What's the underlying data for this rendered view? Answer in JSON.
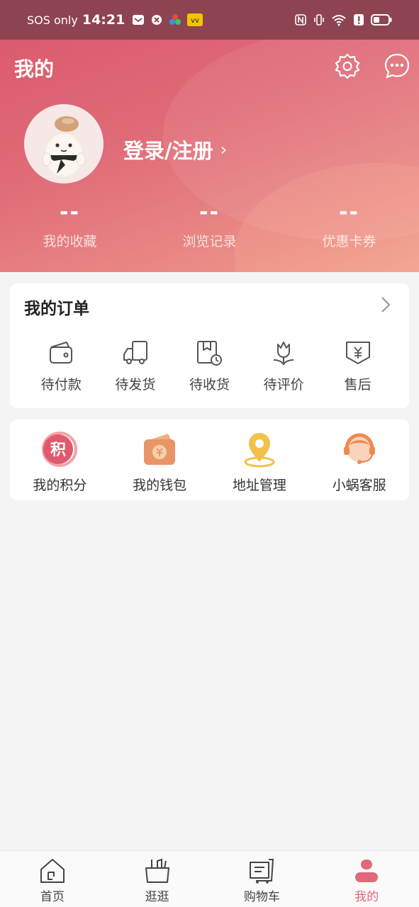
{
  "status_bar": {
    "carrier": "SOS only",
    "time": "14:21"
  },
  "header": {
    "title": "我的",
    "login_label": "登录/注册",
    "chevron": "›"
  },
  "stats": [
    {
      "value": "--",
      "label": "我的收藏"
    },
    {
      "value": "--",
      "label": "浏览记录"
    },
    {
      "value": "--",
      "label": "优惠卡券"
    }
  ],
  "orders": {
    "title": "我的订单",
    "items": [
      {
        "label": "待付款",
        "icon": "wallet-icon"
      },
      {
        "label": "待发货",
        "icon": "truck-icon"
      },
      {
        "label": "待收货",
        "icon": "package-clock-icon"
      },
      {
        "label": "待评价",
        "icon": "flower-icon"
      },
      {
        "label": "售后",
        "icon": "aftersale-yen-icon"
      }
    ]
  },
  "services": {
    "items": [
      {
        "label": "我的积分",
        "icon": "points-icon",
        "badge": "积"
      },
      {
        "label": "我的钱包",
        "icon": "wallet-yen-icon"
      },
      {
        "label": "地址管理",
        "icon": "location-pin-icon"
      },
      {
        "label": "小蜗客服",
        "icon": "customer-service-icon"
      }
    ]
  },
  "bottom_nav": {
    "items": [
      {
        "label": "首页",
        "icon": "home-icon",
        "active": false
      },
      {
        "label": "逛逛",
        "icon": "basket-icon",
        "active": false
      },
      {
        "label": "购物车",
        "icon": "cart-icon",
        "active": false
      },
      {
        "label": "我的",
        "icon": "profile-icon",
        "active": true
      }
    ]
  },
  "colors": {
    "accent": "#e06a7a",
    "header_start": "#d9566a",
    "header_end": "#f0a48f",
    "background": "#f4f4f5"
  }
}
